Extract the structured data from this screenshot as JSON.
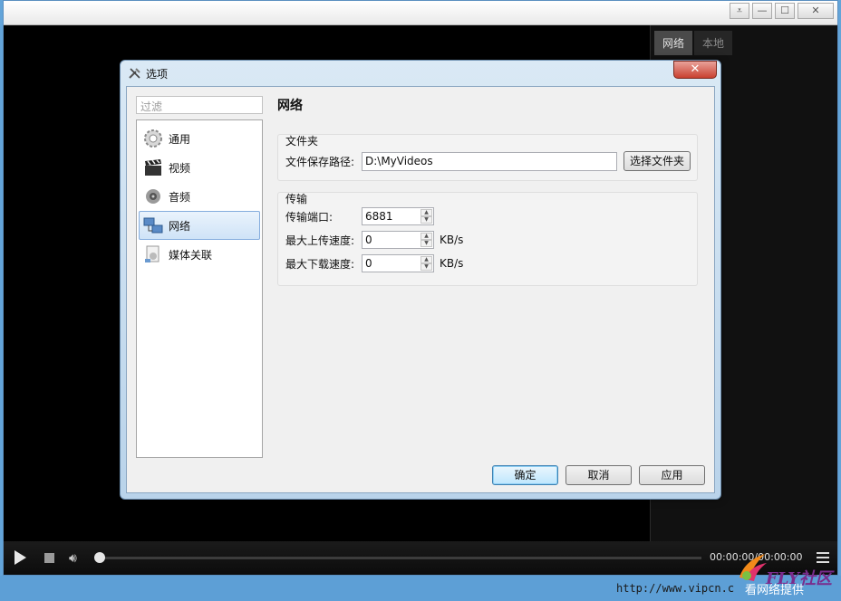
{
  "side_panel": {
    "tabs": [
      "网络",
      "本地"
    ]
  },
  "controls": {
    "time": "00:00:00/00:00:00"
  },
  "watermark": {
    "url": "http://www.vipcn.c",
    "logo_text": "FLY社区",
    "logo_sub": "看网络提供"
  },
  "dialog": {
    "title": "选项",
    "close_label": "✕",
    "filter_placeholder": "过滤",
    "nav": [
      {
        "label": "通用",
        "icon": "gear-icon"
      },
      {
        "label": "视频",
        "icon": "clapperboard-icon"
      },
      {
        "label": "音频",
        "icon": "speaker-icon"
      },
      {
        "label": "网络",
        "icon": "network-icon",
        "selected": true
      },
      {
        "label": "媒体关联",
        "icon": "media-association-icon"
      }
    ],
    "page_title": "网络",
    "folder_group": {
      "title": "文件夹",
      "path_label": "文件保存路径:",
      "path_value": "D:\\MyVideos",
      "choose_button": "选择文件夹"
    },
    "transfer_group": {
      "title": "传输",
      "port_label": "传输端口:",
      "port_value": "6881",
      "upload_label": "最大上传速度:",
      "upload_value": "0",
      "upload_unit": "KB/s",
      "download_label": "最大下载速度:",
      "download_value": "0",
      "download_unit": "KB/s"
    },
    "buttons": {
      "ok": "确定",
      "cancel": "取消",
      "apply": "应用"
    }
  }
}
